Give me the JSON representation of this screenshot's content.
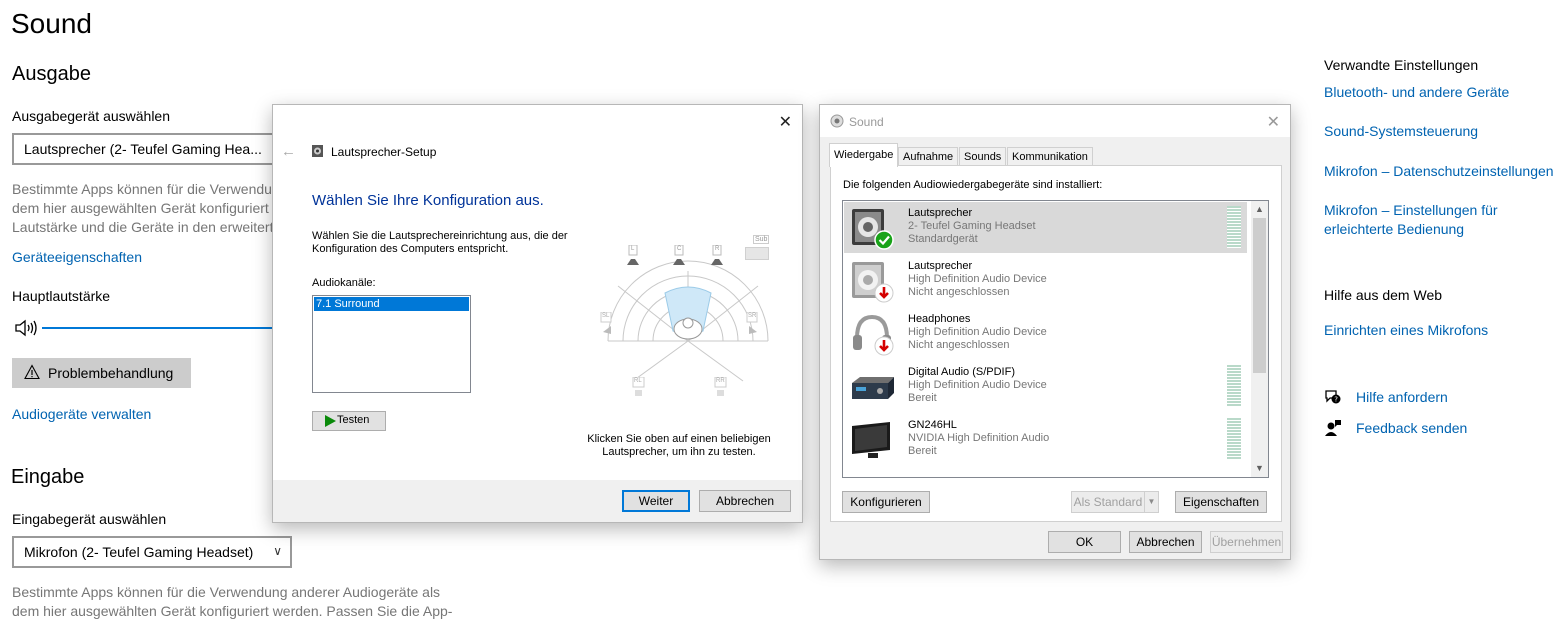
{
  "settings": {
    "title": "Sound",
    "output_heading": "Ausgabe",
    "output_device_label": "Ausgabegerät auswählen",
    "output_device_value": "Lautsprecher (2- Teufel Gaming Hea...",
    "output_desc_lines": [
      "Bestimmte Apps können für die Verwendu",
      "dem hier ausgewählten Gerät konfiguriert",
      "Lautstärke und die Geräte in den erweitert"
    ],
    "device_properties_link": "Geräteeigenschaften",
    "master_volume_label": "Hauptlautstärke",
    "troubleshoot_button": "Problembehandlung",
    "manage_devices_link": "Audiogeräte verwalten",
    "input_heading": "Eingabe",
    "input_device_label": "Eingabegerät auswählen",
    "input_device_value": "Mikrofon (2- Teufel Gaming Headset)",
    "input_desc_lines": [
      "Bestimmte Apps können für die Verwendung anderer Audiogeräte als",
      "dem hier ausgewählten Gerät konfiguriert werden. Passen Sie die App-"
    ]
  },
  "related": {
    "title": "Verwandte Einstellungen",
    "links": [
      "Bluetooth- und andere Geräte",
      "Sound-Systemsteuerung",
      "Mikrofon – Datenschutzeinstellungen",
      "Mikrofon – Einstellungen für erleichterte Bedienung"
    ],
    "help_title": "Hilfe aus dem Web",
    "help_link": "Einrichten eines Mikrofons",
    "get_help": "Hilfe anfordern",
    "feedback": "Feedback senden"
  },
  "speaker_setup": {
    "title": "Lautsprecher-Setup",
    "heading": "Wählen Sie Ihre Konfiguration aus.",
    "instruction": "Wählen Sie die Lautsprechereinrichtung aus, die der Konfiguration des Computers entspricht.",
    "channels_label": "Audiokanäle:",
    "channel_selected": "7.1 Surround",
    "test_button": "Testen",
    "hint": "Klicken Sie oben auf einen beliebigen Lautsprecher, um ihn zu testen.",
    "speaker_labels": [
      "L",
      "C",
      "R",
      "Sub",
      "SL",
      "SR",
      "RL",
      "RR"
    ],
    "next_button": "Weiter",
    "cancel_button": "Abbrechen"
  },
  "sound_dialog": {
    "title": "Sound",
    "tabs": [
      "Wiedergabe",
      "Aufnahme",
      "Sounds",
      "Kommunikation"
    ],
    "installed_label": "Die folgenden Audiowiedergabegeräte sind installiert:",
    "devices": [
      {
        "name": "Lautsprecher",
        "sub": "2- Teufel Gaming Headset",
        "status": "Standardgerät"
      },
      {
        "name": "Lautsprecher",
        "sub": "High Definition Audio Device",
        "status": "Nicht angeschlossen"
      },
      {
        "name": "Headphones",
        "sub": "High Definition Audio Device",
        "status": "Nicht angeschlossen"
      },
      {
        "name": "Digital Audio (S/PDIF)",
        "sub": "High Definition Audio Device",
        "status": "Bereit"
      },
      {
        "name": "GN246HL",
        "sub": "NVIDIA High Definition Audio",
        "status": "Bereit"
      }
    ],
    "configure_button": "Konfigurieren",
    "set_default_button": "Als Standard",
    "properties_button": "Eigenschaften",
    "ok_button": "OK",
    "cancel_button": "Abbrechen",
    "apply_button": "Übernehmen"
  },
  "colors": {
    "accent": "#0078d7",
    "link": "#0063b1",
    "heading_blue": "#003399"
  }
}
